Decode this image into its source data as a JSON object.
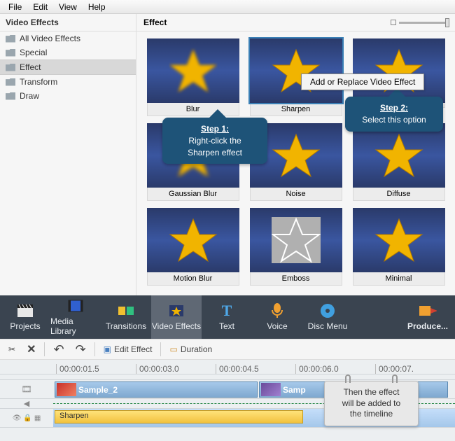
{
  "menu": {
    "file": "File",
    "edit": "Edit",
    "view": "View",
    "help": "Help"
  },
  "sidebar": {
    "title": "Video Effects",
    "items": [
      {
        "label": "All Video Effects",
        "sel": false
      },
      {
        "label": "Special",
        "sel": false
      },
      {
        "label": "Effect",
        "sel": true
      },
      {
        "label": "Transform",
        "sel": false
      },
      {
        "label": "Draw",
        "sel": false
      }
    ]
  },
  "effects_panel": {
    "title": "Effect",
    "effects": [
      {
        "label": "Blur",
        "sel": false
      },
      {
        "label": "Sharpen",
        "sel": true
      },
      {
        "label": "",
        "sel": false
      },
      {
        "label": "Gaussian Blur",
        "sel": false
      },
      {
        "label": "Noise",
        "sel": false
      },
      {
        "label": "Diffuse",
        "sel": false
      },
      {
        "label": "Motion Blur",
        "sel": false
      },
      {
        "label": "Emboss",
        "sel": false
      },
      {
        "label": "Minimal",
        "sel": false
      }
    ]
  },
  "context_menu": {
    "item": "Add or Replace Video Effect"
  },
  "callout1": {
    "step": "Step 1:",
    "text": "Right-click the\nSharpen effect"
  },
  "callout2": {
    "step": "Step 2:",
    "text": "Select this option"
  },
  "toolbar": {
    "projects": "Projects",
    "media": "Media Library",
    "transitions": "Transitions",
    "videoeffects": "Video Effects",
    "text": "Text",
    "voice": "Voice",
    "disc": "Disc Menu",
    "produce": "Produce..."
  },
  "editbar": {
    "edit_effect": "Edit Effect",
    "duration": "Duration"
  },
  "ruler": [
    "00:00:01.5",
    "00:00:03.0",
    "00:00:04.5",
    "00:00:06.0",
    "00:00:07."
  ],
  "timeline": {
    "clip1": "Sample_2",
    "clip2": "Samp",
    "fx": "Sharpen"
  },
  "note": "Then the effect\nwill be added to\nthe timeline"
}
